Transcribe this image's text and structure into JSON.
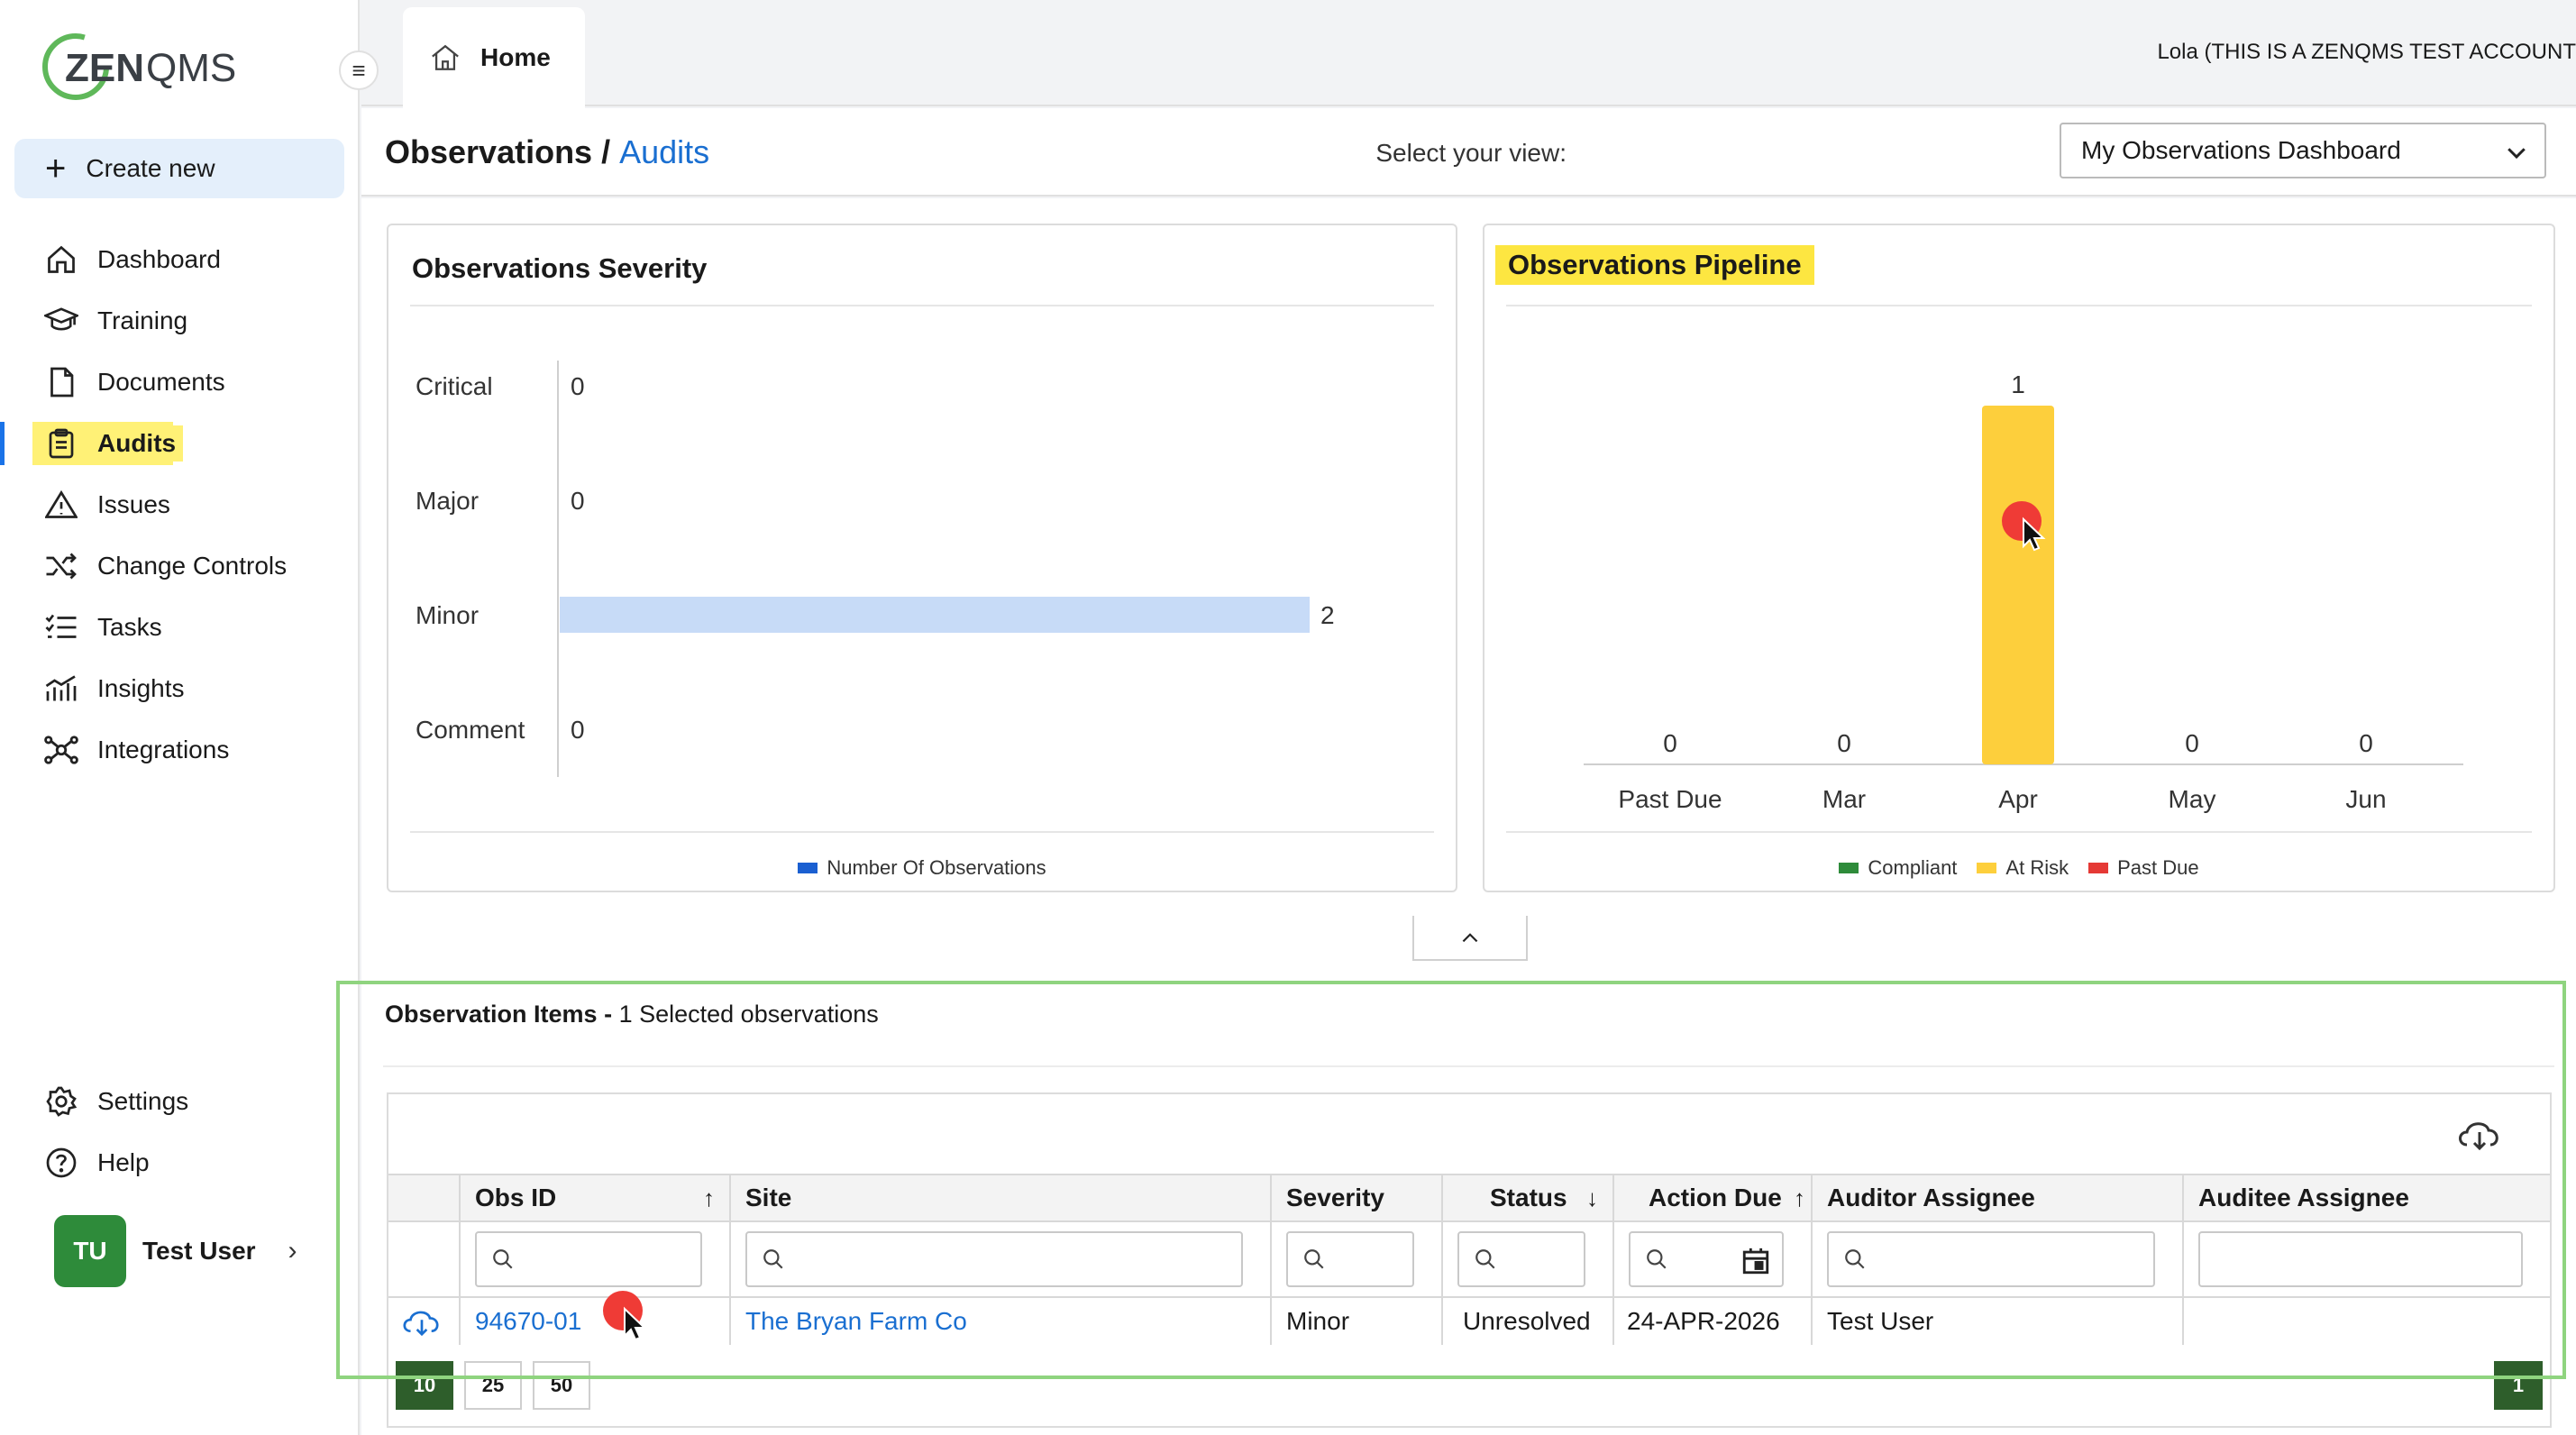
{
  "app": {
    "logo_text": "ZENQMS",
    "account_label": "Lola (THIS IS A ZENQMS TEST ACCOUNT"
  },
  "colors": {
    "accent": "#1a73e8",
    "highlight": "#fff176",
    "green": "#2e8b3a",
    "at_risk": "#fdcf3c",
    "compliant": "#2e8b3a",
    "past_due": "#e53935",
    "minor_bar": "#c7dbf7"
  },
  "sidebar": {
    "create_new": "Create new",
    "items": [
      {
        "label": "Dashboard",
        "icon": "home-icon"
      },
      {
        "label": "Training",
        "icon": "graduation-cap-icon"
      },
      {
        "label": "Documents",
        "icon": "document-icon"
      },
      {
        "label": "Audits",
        "icon": "clipboard-icon",
        "active": true
      },
      {
        "label": "Issues",
        "icon": "warning-icon"
      },
      {
        "label": "Change Controls",
        "icon": "shuffle-icon"
      },
      {
        "label": "Tasks",
        "icon": "checklist-icon"
      },
      {
        "label": "Insights",
        "icon": "chart-icon"
      },
      {
        "label": "Integrations",
        "icon": "network-icon"
      }
    ],
    "bottom_items": [
      {
        "label": "Settings",
        "icon": "gear-icon"
      },
      {
        "label": "Help",
        "icon": "help-icon"
      }
    ],
    "user": {
      "initials": "TU",
      "name": "Test User"
    }
  },
  "topbar": {
    "home_tab": "Home"
  },
  "header": {
    "title": "Observations /",
    "title_link": "Audits",
    "view_label": "Select your view:",
    "view_value": "My Observations Dashboard"
  },
  "severity_chart": {
    "title": "Observations Severity",
    "legend": "Number Of Observations"
  },
  "pipeline_chart": {
    "title": "Observations Pipeline",
    "legend": [
      "Compliant",
      "At Risk",
      "Past Due"
    ]
  },
  "chart_data": [
    {
      "type": "bar",
      "orientation": "horizontal",
      "title": "Observations Severity",
      "categories": [
        "Critical",
        "Major",
        "Minor",
        "Comment"
      ],
      "series": [
        {
          "name": "Number Of Observations",
          "values": [
            0,
            0,
            2,
            0
          ]
        }
      ],
      "xlim": [
        0,
        2
      ]
    },
    {
      "type": "bar",
      "title": "Observations Pipeline",
      "categories": [
        "Past Due",
        "Mar",
        "Apr",
        "May",
        "Jun"
      ],
      "values": [
        0,
        0,
        1,
        0,
        0
      ],
      "legend_entries": [
        "Compliant",
        "At Risk",
        "Past Due"
      ],
      "ylim": [
        0,
        1
      ]
    }
  ],
  "items": {
    "title": "Observation Items -",
    "subtitle": "1 Selected observations",
    "columns": [
      "Obs ID",
      "Site",
      "Severity",
      "Status",
      "Action Due",
      "Auditor Assignee",
      "Auditee Assignee"
    ],
    "row": {
      "obs_id": "94670-01",
      "site": "The Bryan Farm Co",
      "severity": "Minor",
      "status": "Unresolved",
      "action_due": "24-APR-2026",
      "auditor": "Test User",
      "auditee": ""
    },
    "page_sizes": [
      "10",
      "25",
      "50"
    ],
    "current_page": "1"
  }
}
